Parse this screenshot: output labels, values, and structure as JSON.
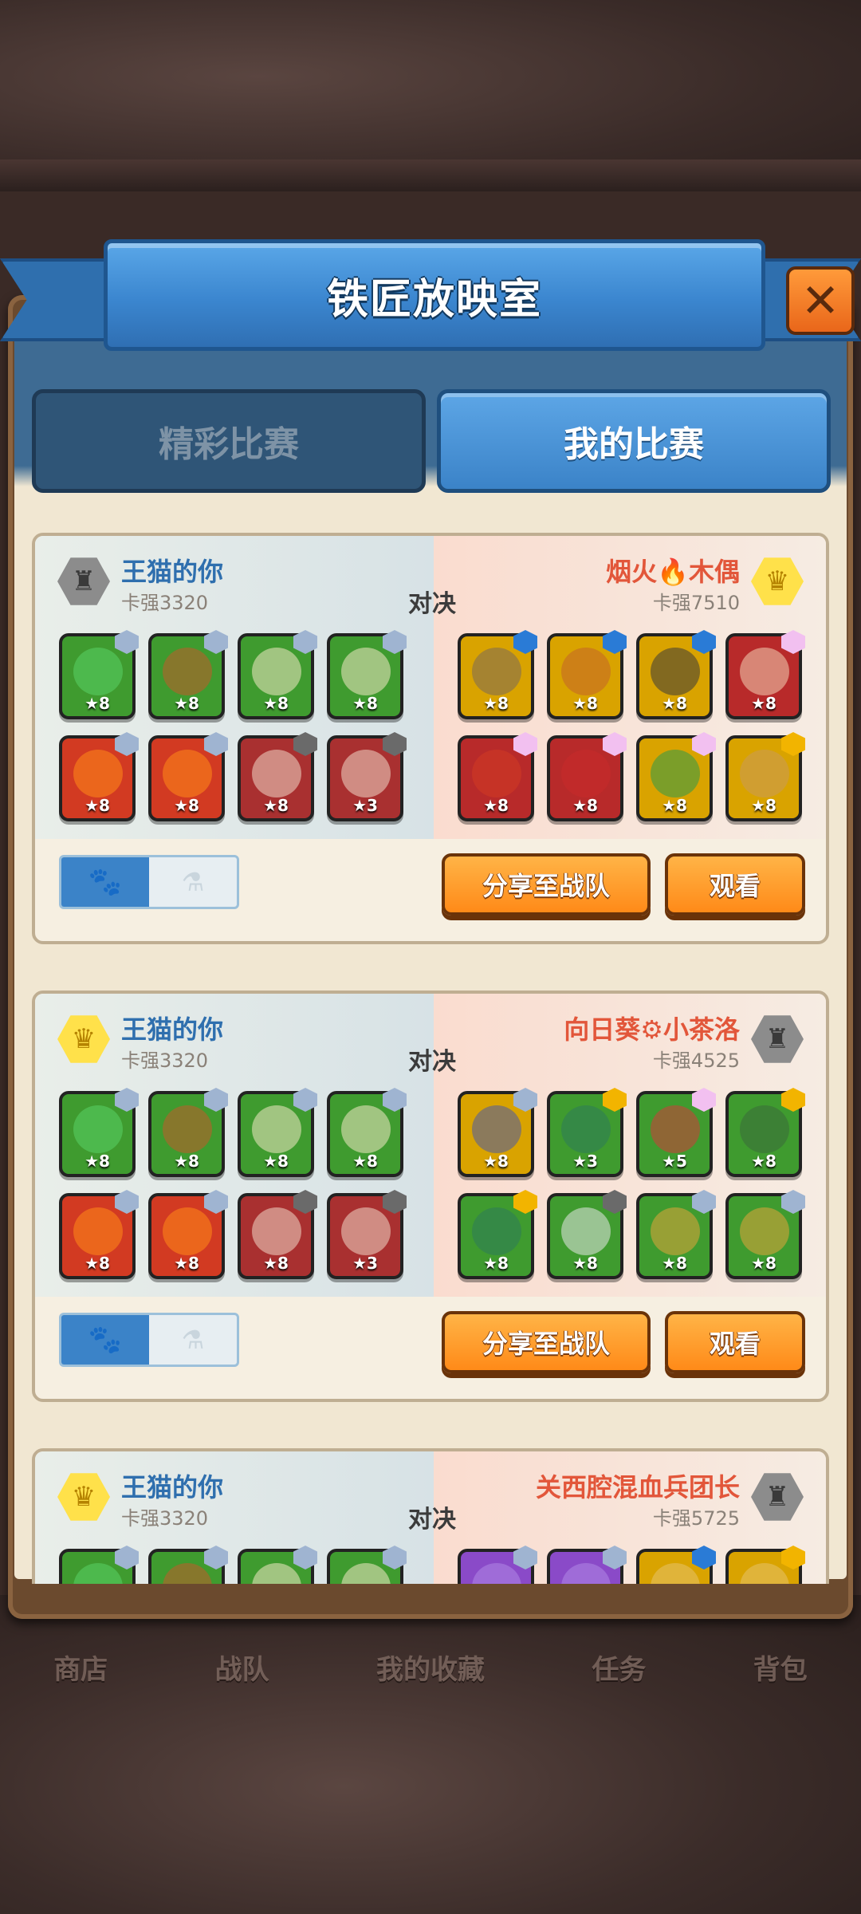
{
  "screen": {
    "title": "铁匠放映室",
    "close_icon": "✕"
  },
  "tabs": [
    {
      "label": "精彩比赛",
      "active": false
    },
    {
      "label": "我的比赛",
      "active": true
    }
  ],
  "bottom_nav": [
    "商店",
    "战队",
    "我的收藏",
    "任务",
    "背包"
  ],
  "versus_label": "对决",
  "buttons": {
    "share": "分享至战队",
    "watch": "观看"
  },
  "toggle": {
    "on_icon": "paw-icon",
    "off_icon": "potion-icon"
  },
  "colors": {
    "accent_blue": "#3b83c8",
    "accent_orange": "#ff8a18",
    "enemy_red": "#e2563a"
  },
  "matches": [
    {
      "left": {
        "name": "王猫的你",
        "rank": "卡强3320",
        "badge": "silver",
        "units": [
          {
            "lv": "★8",
            "color": "#3f9b2f",
            "gem": "#9fb4d1",
            "sprite": "#5ad266"
          },
          {
            "lv": "★8",
            "color": "#3f9b2f",
            "gem": "#9fb4d1",
            "sprite": "#c35a2a"
          },
          {
            "lv": "★8",
            "color": "#3f9b2f",
            "gem": "#9fb4d1",
            "sprite": "#f3e7c4"
          },
          {
            "lv": "★8",
            "color": "#3f9b2f",
            "gem": "#9fb4d1",
            "sprite": "#f3e7c4"
          },
          {
            "lv": "★8",
            "color": "#d23a22",
            "gem": "#9fb4d1",
            "sprite": "#ff8a18"
          },
          {
            "lv": "★8",
            "color": "#d23a22",
            "gem": "#9fb4d1",
            "sprite": "#ff8a18"
          },
          {
            "lv": "★8",
            "color": "#a93030",
            "gem": "#6a6a6a",
            "sprite": "#f0d8c8"
          },
          {
            "lv": "★3",
            "color": "#a93030",
            "gem": "#6a6a6a",
            "sprite": "#f0d8c8"
          }
        ]
      },
      "right": {
        "name": "烟火🔥木偶",
        "rank": "卡强7510",
        "badge": "gold",
        "units": [
          {
            "lv": "★8",
            "color": "#d9a300",
            "gem": "#2a7bd6",
            "sprite": "#7a6a5a"
          },
          {
            "lv": "★8",
            "color": "#d9a300",
            "gem": "#2a7bd6",
            "sprite": "#c3642a"
          },
          {
            "lv": "★8",
            "color": "#d9a300",
            "gem": "#2a7bd6",
            "sprite": "#3a3a3a"
          },
          {
            "lv": "★8",
            "color": "#b82a2a",
            "gem": "#f2c0f0",
            "sprite": "#f3d2b4"
          },
          {
            "lv": "★8",
            "color": "#b82a2a",
            "gem": "#f2c0f0",
            "sprite": "#d23a22"
          },
          {
            "lv": "★8",
            "color": "#b82a2a",
            "gem": "#f2c0f0",
            "sprite": "#c82a2a"
          },
          {
            "lv": "★8",
            "color": "#d9a300",
            "gem": "#f2c0f0",
            "sprite": "#2e9a4a"
          },
          {
            "lv": "★8",
            "color": "#d9a300",
            "gem": "#f2b400",
            "sprite": "#c89a5a"
          }
        ]
      }
    },
    {
      "left": {
        "name": "王猫的你",
        "rank": "卡强3320",
        "badge": "gold",
        "units": [
          {
            "lv": "★8",
            "color": "#3f9b2f",
            "gem": "#9fb4d1",
            "sprite": "#5ad266"
          },
          {
            "lv": "★8",
            "color": "#3f9b2f",
            "gem": "#9fb4d1",
            "sprite": "#c35a2a"
          },
          {
            "lv": "★8",
            "color": "#3f9b2f",
            "gem": "#9fb4d1",
            "sprite": "#f3e7c4"
          },
          {
            "lv": "★8",
            "color": "#3f9b2f",
            "gem": "#9fb4d1",
            "sprite": "#f3e7c4"
          },
          {
            "lv": "★8",
            "color": "#d23a22",
            "gem": "#9fb4d1",
            "sprite": "#ff8a18"
          },
          {
            "lv": "★8",
            "color": "#d23a22",
            "gem": "#9fb4d1",
            "sprite": "#ff8a18"
          },
          {
            "lv": "★8",
            "color": "#a93030",
            "gem": "#6a6a6a",
            "sprite": "#f0d8c8"
          },
          {
            "lv": "★3",
            "color": "#a93030",
            "gem": "#6a6a6a",
            "sprite": "#f0d8c8"
          }
        ]
      },
      "right": {
        "name": "向日葵⚙小茶洛",
        "rank": "卡强4525",
        "badge": "silver",
        "units": [
          {
            "lv": "★8",
            "color": "#d9a300",
            "gem": "#9fb4d1",
            "sprite": "#4a5aa8"
          },
          {
            "lv": "★3",
            "color": "#3f9b2f",
            "gem": "#f2b400",
            "sprite": "#2e7a5a"
          },
          {
            "lv": "★5",
            "color": "#3f9b2f",
            "gem": "#f2c0f0",
            "sprite": "#d23a3a"
          },
          {
            "lv": "★8",
            "color": "#3f9b2f",
            "gem": "#f2b400",
            "sprite": "#3a6a3a"
          },
          {
            "lv": "★8",
            "color": "#3f9b2f",
            "gem": "#f2b400",
            "sprite": "#2e7a5a"
          },
          {
            "lv": "★8",
            "color": "#3f9b2f",
            "gem": "#6a6a6a",
            "sprite": "#e6e6e6"
          },
          {
            "lv": "★8",
            "color": "#3f9b2f",
            "gem": "#9fb4d1",
            "sprite": "#e2a43a"
          },
          {
            "lv": "★8",
            "color": "#3f9b2f",
            "gem": "#9fb4d1",
            "sprite": "#e2a43a"
          }
        ]
      }
    },
    {
      "left": {
        "name": "王猫的你",
        "rank": "卡强3320",
        "badge": "gold",
        "units": [
          {
            "lv": "",
            "color": "#3f9b2f",
            "gem": "#9fb4d1",
            "sprite": "#5ad266"
          },
          {
            "lv": "",
            "color": "#3f9b2f",
            "gem": "#9fb4d1",
            "sprite": "#c35a2a"
          },
          {
            "lv": "",
            "color": "#3f9b2f",
            "gem": "#9fb4d1",
            "sprite": "#f3e7c4"
          },
          {
            "lv": "",
            "color": "#3f9b2f",
            "gem": "#9fb4d1",
            "sprite": "#f3e7c4"
          }
        ]
      },
      "right": {
        "name": "关西腔混血兵团长",
        "rank": "卡强5725",
        "badge": "silver",
        "units": [
          {
            "lv": "",
            "color": "#8a4ac8",
            "gem": "#9fb4d1",
            "sprite": "#b088e6"
          },
          {
            "lv": "",
            "color": "#8a4ac8",
            "gem": "#9fb4d1",
            "sprite": "#b088e6"
          },
          {
            "lv": "",
            "color": "#d9a300",
            "gem": "#2a7bd6",
            "sprite": "#e6c26a"
          },
          {
            "lv": "",
            "color": "#d9a300",
            "gem": "#f2b400",
            "sprite": "#e6c26a"
          }
        ]
      }
    }
  ]
}
